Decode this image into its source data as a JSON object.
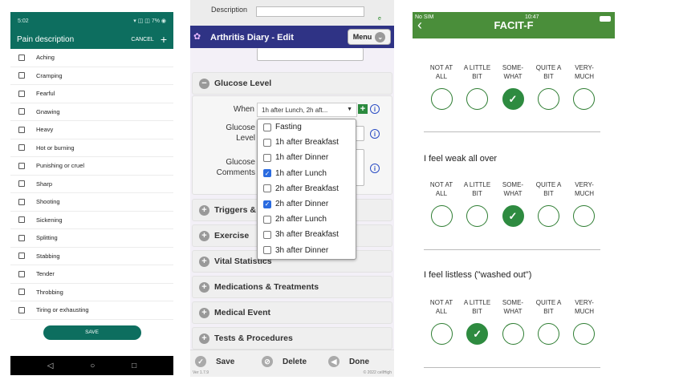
{
  "pain": {
    "status_time": "5:02",
    "status_right": "7%",
    "title": "Pain description",
    "cancel": "CANCEL",
    "plus": "+",
    "items": [
      "Aching",
      "Cramping",
      "Fearful",
      "Gnawing",
      "Heavy",
      "Hot or burning",
      "Punishing or cruel",
      "Sharp",
      "Shooting",
      "Sickening",
      "Splitting",
      "Stabbing",
      "Tender",
      "Throbbing",
      "Tiring or exhausting"
    ],
    "save": "SAVE",
    "nav": {
      "back": "◁",
      "home": "○",
      "recent": "□"
    }
  },
  "arthritis": {
    "description_label": "Description",
    "e_mark": "e",
    "title": "Arthritis Diary - Edit",
    "menu": "Menu",
    "glucose_section": "Glucose Level",
    "when_label": "When",
    "when_value": "1h after Lunch, 2h aft...",
    "glucose_level_label": "Glucose Level",
    "glucose_comments_label": "Glucose Comments",
    "dropdown": [
      {
        "label": "Fasting",
        "checked": false
      },
      {
        "label": "1h after Breakfast",
        "checked": false
      },
      {
        "label": "1h after Dinner",
        "checked": false
      },
      {
        "label": "1h after Lunch",
        "checked": true
      },
      {
        "label": "2h after Breakfast",
        "checked": false
      },
      {
        "label": "2h after Dinner",
        "checked": true
      },
      {
        "label": "2h after Lunch",
        "checked": false
      },
      {
        "label": "3h after Breakfast",
        "checked": false
      },
      {
        "label": "3h after Dinner",
        "checked": false
      }
    ],
    "sections": [
      "Triggers & ...",
      "Exercise",
      "Vital Statistics",
      "Medications & Treatments",
      "Medical Event",
      "Tests & Procedures"
    ],
    "footer": {
      "save": "Save",
      "delete": "Delete",
      "done": "Done",
      "version": "Ver 1.7.9",
      "copyright": "© 2022 cellHigh"
    }
  },
  "facit": {
    "status_sim": "No SIM",
    "status_time": "10:47",
    "title": "FACIT-F",
    "options": [
      "NOT AT\nALL",
      "A LITTLE\nBIT",
      "SOME-\nWHAT",
      "QUITE A\nBIT",
      "VERY-\nMUCH"
    ],
    "questions": [
      {
        "text": "",
        "selected": 2
      },
      {
        "text": "I feel weak all over",
        "selected": 2
      },
      {
        "text": "I feel listless (\"washed out\")",
        "selected": 1
      }
    ]
  },
  "colors": {
    "teal": "#0d6e5f",
    "navy": "#2f3385",
    "green": "#4a8e3a"
  }
}
